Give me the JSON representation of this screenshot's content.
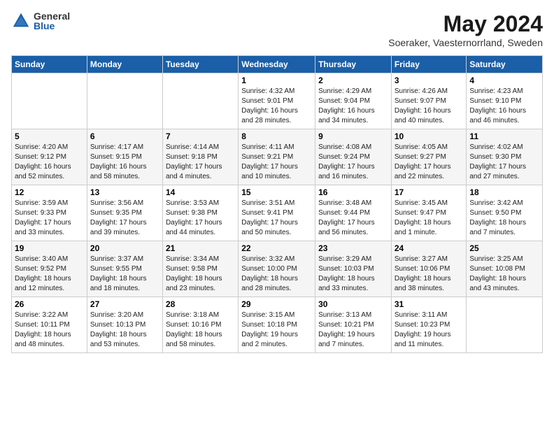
{
  "logo": {
    "general": "General",
    "blue": "Blue"
  },
  "title": "May 2024",
  "subtitle": "Soeraker, Vaesternorrland, Sweden",
  "days_header": [
    "Sunday",
    "Monday",
    "Tuesday",
    "Wednesday",
    "Thursday",
    "Friday",
    "Saturday"
  ],
  "weeks": [
    [
      {
        "day": "",
        "info": ""
      },
      {
        "day": "",
        "info": ""
      },
      {
        "day": "",
        "info": ""
      },
      {
        "day": "1",
        "info": "Sunrise: 4:32 AM\nSunset: 9:01 PM\nDaylight: 16 hours\nand 28 minutes."
      },
      {
        "day": "2",
        "info": "Sunrise: 4:29 AM\nSunset: 9:04 PM\nDaylight: 16 hours\nand 34 minutes."
      },
      {
        "day": "3",
        "info": "Sunrise: 4:26 AM\nSunset: 9:07 PM\nDaylight: 16 hours\nand 40 minutes."
      },
      {
        "day": "4",
        "info": "Sunrise: 4:23 AM\nSunset: 9:10 PM\nDaylight: 16 hours\nand 46 minutes."
      }
    ],
    [
      {
        "day": "5",
        "info": "Sunrise: 4:20 AM\nSunset: 9:12 PM\nDaylight: 16 hours\nand 52 minutes."
      },
      {
        "day": "6",
        "info": "Sunrise: 4:17 AM\nSunset: 9:15 PM\nDaylight: 16 hours\nand 58 minutes."
      },
      {
        "day": "7",
        "info": "Sunrise: 4:14 AM\nSunset: 9:18 PM\nDaylight: 17 hours\nand 4 minutes."
      },
      {
        "day": "8",
        "info": "Sunrise: 4:11 AM\nSunset: 9:21 PM\nDaylight: 17 hours\nand 10 minutes."
      },
      {
        "day": "9",
        "info": "Sunrise: 4:08 AM\nSunset: 9:24 PM\nDaylight: 17 hours\nand 16 minutes."
      },
      {
        "day": "10",
        "info": "Sunrise: 4:05 AM\nSunset: 9:27 PM\nDaylight: 17 hours\nand 22 minutes."
      },
      {
        "day": "11",
        "info": "Sunrise: 4:02 AM\nSunset: 9:30 PM\nDaylight: 17 hours\nand 27 minutes."
      }
    ],
    [
      {
        "day": "12",
        "info": "Sunrise: 3:59 AM\nSunset: 9:33 PM\nDaylight: 17 hours\nand 33 minutes."
      },
      {
        "day": "13",
        "info": "Sunrise: 3:56 AM\nSunset: 9:35 PM\nDaylight: 17 hours\nand 39 minutes."
      },
      {
        "day": "14",
        "info": "Sunrise: 3:53 AM\nSunset: 9:38 PM\nDaylight: 17 hours\nand 44 minutes."
      },
      {
        "day": "15",
        "info": "Sunrise: 3:51 AM\nSunset: 9:41 PM\nDaylight: 17 hours\nand 50 minutes."
      },
      {
        "day": "16",
        "info": "Sunrise: 3:48 AM\nSunset: 9:44 PM\nDaylight: 17 hours\nand 56 minutes."
      },
      {
        "day": "17",
        "info": "Sunrise: 3:45 AM\nSunset: 9:47 PM\nDaylight: 18 hours\nand 1 minute."
      },
      {
        "day": "18",
        "info": "Sunrise: 3:42 AM\nSunset: 9:50 PM\nDaylight: 18 hours\nand 7 minutes."
      }
    ],
    [
      {
        "day": "19",
        "info": "Sunrise: 3:40 AM\nSunset: 9:52 PM\nDaylight: 18 hours\nand 12 minutes."
      },
      {
        "day": "20",
        "info": "Sunrise: 3:37 AM\nSunset: 9:55 PM\nDaylight: 18 hours\nand 18 minutes."
      },
      {
        "day": "21",
        "info": "Sunrise: 3:34 AM\nSunset: 9:58 PM\nDaylight: 18 hours\nand 23 minutes."
      },
      {
        "day": "22",
        "info": "Sunrise: 3:32 AM\nSunset: 10:00 PM\nDaylight: 18 hours\nand 28 minutes."
      },
      {
        "day": "23",
        "info": "Sunrise: 3:29 AM\nSunset: 10:03 PM\nDaylight: 18 hours\nand 33 minutes."
      },
      {
        "day": "24",
        "info": "Sunrise: 3:27 AM\nSunset: 10:06 PM\nDaylight: 18 hours\nand 38 minutes."
      },
      {
        "day": "25",
        "info": "Sunrise: 3:25 AM\nSunset: 10:08 PM\nDaylight: 18 hours\nand 43 minutes."
      }
    ],
    [
      {
        "day": "26",
        "info": "Sunrise: 3:22 AM\nSunset: 10:11 PM\nDaylight: 18 hours\nand 48 minutes."
      },
      {
        "day": "27",
        "info": "Sunrise: 3:20 AM\nSunset: 10:13 PM\nDaylight: 18 hours\nand 53 minutes."
      },
      {
        "day": "28",
        "info": "Sunrise: 3:18 AM\nSunset: 10:16 PM\nDaylight: 18 hours\nand 58 minutes."
      },
      {
        "day": "29",
        "info": "Sunrise: 3:15 AM\nSunset: 10:18 PM\nDaylight: 19 hours\nand 2 minutes."
      },
      {
        "day": "30",
        "info": "Sunrise: 3:13 AM\nSunset: 10:21 PM\nDaylight: 19 hours\nand 7 minutes."
      },
      {
        "day": "31",
        "info": "Sunrise: 3:11 AM\nSunset: 10:23 PM\nDaylight: 19 hours\nand 11 minutes."
      },
      {
        "day": "",
        "info": ""
      }
    ]
  ]
}
